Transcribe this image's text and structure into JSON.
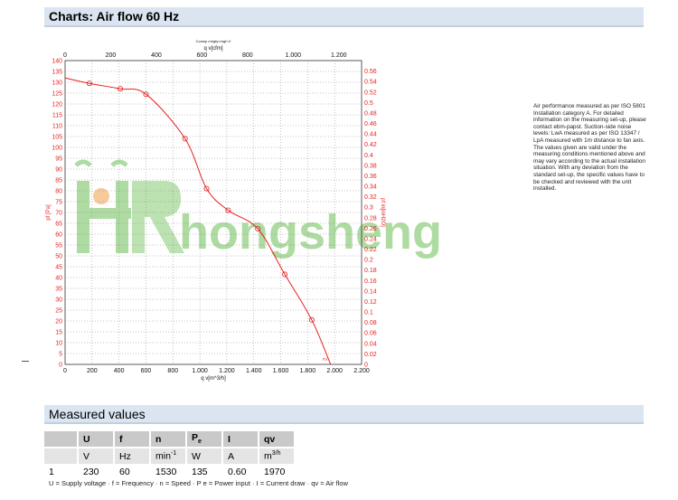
{
  "header": {
    "title": "Charts: Air flow 60 Hz"
  },
  "chart_data": {
    "type": "line",
    "subtitle": "Ccamp   mirgfy:mrgf=V",
    "xlabel": "q v[m^3/h]",
    "x2label": "q v[cfm]",
    "ylabel": "pf [Pa]",
    "y2label": "pf in[inH2O]",
    "xlim": [
      0,
      2200
    ],
    "ylim": [
      0,
      140
    ],
    "x2lim": [
      0,
      1300
    ],
    "y2lim": [
      0,
      0.58
    ],
    "x_ticks": [
      "0",
      "200",
      "400",
      "600",
      "800",
      "1.000",
      "1.200",
      "1.400",
      "1.600",
      "1.800",
      "2.000",
      "2.200"
    ],
    "x2_ticks": [
      "0",
      "200",
      "400",
      "600",
      "800",
      "1.000",
      "1.200"
    ],
    "y_ticks": [
      "0",
      "5",
      "10",
      "15",
      "20",
      "25",
      "30",
      "35",
      "40",
      "45",
      "50",
      "55",
      "60",
      "65",
      "70",
      "75",
      "80",
      "85",
      "90",
      "95",
      "100",
      "105",
      "110",
      "115",
      "120",
      "125",
      "130",
      "135",
      "140"
    ],
    "y2_ticks": [
      "0",
      "0.02",
      "0.04",
      "0.06",
      "0.08",
      "0.1",
      "0.12",
      "0.14",
      "0.16",
      "0.18",
      "0.2",
      "0.22",
      "0.24",
      "0.26",
      "0.28",
      "0.3",
      "0.32",
      "0.34",
      "0.36",
      "0.38",
      "0.4",
      "0.42",
      "0.44",
      "0.46",
      "0.48",
      "0.5",
      "0.52",
      "0.54",
      "0.56"
    ],
    "grid": true,
    "series": [
      {
        "color": "#e82020",
        "x": [
          0,
          180,
          410,
          600,
          890,
          1050,
          1210,
          1430,
          1630,
          1830,
          1970
        ],
        "y": [
          132,
          129.5,
          127,
          124.5,
          104,
          81,
          71,
          62.5,
          41.5,
          20.5,
          0
        ]
      }
    ],
    "curve_label": "2"
  },
  "watermark": {
    "text": "hongsheng",
    "color": "#6cbf55"
  },
  "note": "Air performance measured as per ISO 5801 Installation category A. For detailed information on the measuring set-up, please contact ebm-papst. Suction-side noise levels: LwA measured as per ISO 13347 / LpA measured with 1m distance to fan axis. The values given are valid under the measuring conditions mentioned above and may vary according to the actual installation situation. With any deviation from the standard set-up, the specific values have to be checked and reviewed with the unit installed.",
  "measured": {
    "title": "Measured values",
    "headers": [
      "",
      "U",
      "f",
      "n",
      "P",
      "I",
      "qv"
    ],
    "pe_sub": "e",
    "units": [
      "",
      "V",
      "Hz",
      "min",
      "W",
      "A",
      "m"
    ],
    "min_sup": "-1",
    "m_suffix": "3/h",
    "rows": [
      [
        "1",
        "230",
        "60",
        "1530",
        "135",
        "0.60",
        "1970"
      ]
    ],
    "footnote": "U = Supply voltage · f = Frequency · n = Speed · P e = Power input · I = Current draw · qv = Air flow"
  }
}
